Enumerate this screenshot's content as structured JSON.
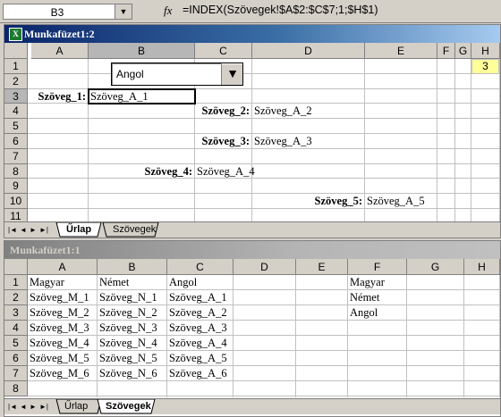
{
  "formula_bar": {
    "name_box": "B3",
    "name_box_arrow": "▼",
    "fx_label": "fx",
    "formula": "=INDEX(Szövegek!$A$2:$C$7;1;$H$1)"
  },
  "window1": {
    "title": "Munkafüzet1:2",
    "col_headers": [
      "A",
      "B",
      "C",
      "D",
      "E",
      "F",
      "G",
      "H"
    ],
    "row_headers": [
      "1",
      "2",
      "3",
      "4",
      "5",
      "6",
      "7",
      "8",
      "9",
      "10",
      "11"
    ],
    "dropdown": {
      "value": "Angol",
      "arrow": "▼"
    },
    "h1_value": "3",
    "labels": [
      "Szöveg_1:",
      "Szöveg_2:",
      "Szöveg_3:",
      "Szöveg_4:",
      "Szöveg_5:"
    ],
    "values": [
      "Szöveg_A_1",
      "Szöveg_A_2",
      "Szöveg_A_3",
      "Szöveg_A_4",
      "Szöveg_A_5"
    ],
    "tabs": [
      "Űrlap",
      "Szövegek"
    ],
    "active_tab": "Űrlap"
  },
  "window2": {
    "title": "Munkafüzet1:1",
    "col_headers": [
      "A",
      "B",
      "C",
      "D",
      "E",
      "F",
      "G",
      "H"
    ],
    "row_headers": [
      "1",
      "2",
      "3",
      "4",
      "5",
      "6",
      "7",
      "8"
    ],
    "rows": [
      [
        "Magyar",
        "Német",
        "Angol"
      ],
      [
        "Szöveg_M_1",
        "Szöveg_N_1",
        "Szöveg_A_1"
      ],
      [
        "Szöveg_M_2",
        "Szöveg_N_2",
        "Szöveg_A_2"
      ],
      [
        "Szöveg_M_3",
        "Szöveg_N_3",
        "Szöveg_A_3"
      ],
      [
        "Szöveg_M_4",
        "Szöveg_N_4",
        "Szöveg_A_4"
      ],
      [
        "Szöveg_M_5",
        "Szöveg_N_5",
        "Szöveg_A_5"
      ],
      [
        "Szöveg_M_6",
        "Szöveg_N_6",
        "Szöveg_A_6"
      ]
    ],
    "f_column": [
      "Magyar",
      "Német",
      "Angol"
    ],
    "tabs": [
      "Űrlap",
      "Szövegek"
    ],
    "active_tab": "Szövegek"
  },
  "nav_buttons": [
    "|◄",
    "◄",
    "►",
    "►|"
  ]
}
